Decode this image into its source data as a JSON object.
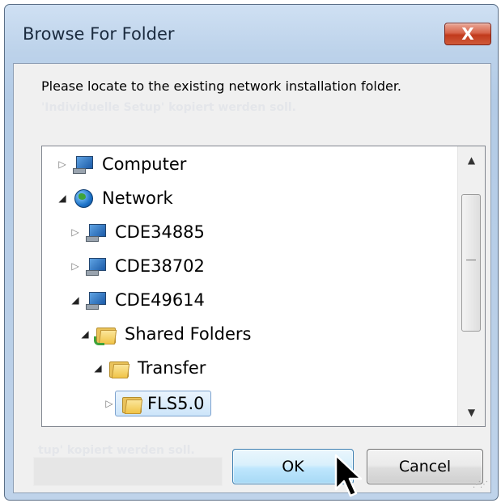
{
  "window": {
    "title": "Browse For Folder",
    "close_label": "X"
  },
  "prompt": "Please locate to the existing network installation folder.",
  "background_text": {
    "line1": "'Individuelle Setup' kopiert werden soll.",
    "line2": "tup' kopiert werden soll."
  },
  "tree": {
    "nodes": [
      {
        "label": "Computer",
        "icon": "computer-icon",
        "expanded": false
      },
      {
        "label": "Network",
        "icon": "network-globe-icon",
        "expanded": true
      },
      {
        "label": "CDE34885",
        "icon": "computer-icon",
        "expanded": false
      },
      {
        "label": "CDE38702",
        "icon": "computer-icon",
        "expanded": false
      },
      {
        "label": "CDE49614",
        "icon": "computer-icon",
        "expanded": true
      },
      {
        "label": "Shared Folders",
        "icon": "shared-folder-icon",
        "expanded": true
      },
      {
        "label": "Transfer",
        "icon": "folder-icon",
        "expanded": true
      },
      {
        "label": "FLS5.0",
        "icon": "folder-icon",
        "expanded": false,
        "selected": true
      }
    ]
  },
  "buttons": {
    "ok": "OK",
    "cancel": "Cancel"
  },
  "icons": {
    "collapsed": "▷",
    "expanded": "◢",
    "scroll_up": "▲",
    "scroll_down": "▼"
  }
}
